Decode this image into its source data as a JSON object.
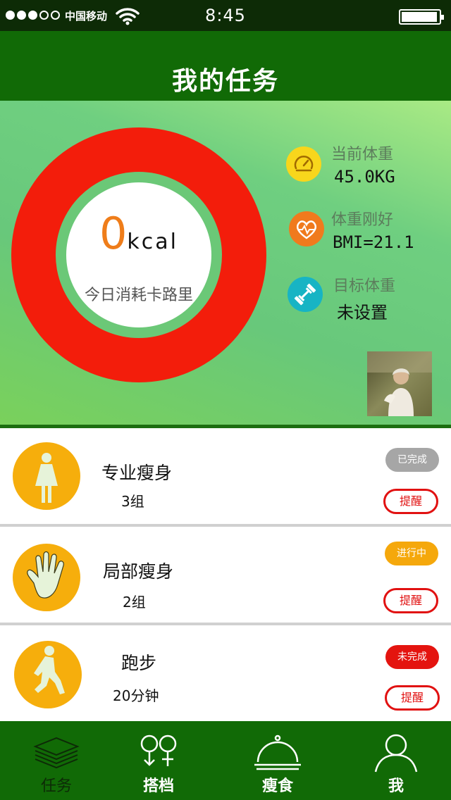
{
  "status_bar": {
    "carrier": "中国移动",
    "time": "8:45"
  },
  "header": {
    "title": "我的任务"
  },
  "calories": {
    "value": "0",
    "unit": "kcal",
    "label": "今日消耗卡路里",
    "ring_color": "#f31d0b",
    "value_color": "#ef7d1a"
  },
  "stats": [
    {
      "title": "当前体重",
      "value": "45.0KG",
      "icon": "gauge-icon",
      "color": "#f8d61c"
    },
    {
      "title": "体重刚好",
      "value": "BMI=21.1",
      "icon": "heart-pulse-icon",
      "color": "#f07a1d"
    },
    {
      "title": "目标体重",
      "value": "未设置",
      "icon": "dumbbell-icon",
      "color": "#17b4c4"
    }
  ],
  "tasks": [
    {
      "name": "专业瘦身",
      "detail": "3组",
      "status": "已完成",
      "status_color": "#a6a6a6",
      "remind": "提醒",
      "icon": "woman-figure-icon"
    },
    {
      "name": "局部瘦身",
      "detail": "2组",
      "status": "进行中",
      "status_color": "#f5a80c",
      "remind": "提醒",
      "icon": "hand-icon"
    },
    {
      "name": "跑步",
      "detail": "20分钟",
      "status": "未完成",
      "status_color": "#e4140f",
      "remind": "提醒",
      "icon": "runner-icon"
    }
  ],
  "tabs": [
    {
      "label": "任务",
      "icon": "stack-icon",
      "active": true
    },
    {
      "label": "搭档",
      "icon": "gender-icon",
      "active": false
    },
    {
      "label": "瘦食",
      "icon": "dish-cover-icon",
      "active": false
    },
    {
      "label": "我",
      "icon": "user-icon",
      "active": false
    }
  ],
  "colors": {
    "header_bg": "#116a06",
    "status_bar_bg": "#0d2b06",
    "task_icon_bg": "#f6ae0c",
    "remind_red": "#e11111"
  }
}
